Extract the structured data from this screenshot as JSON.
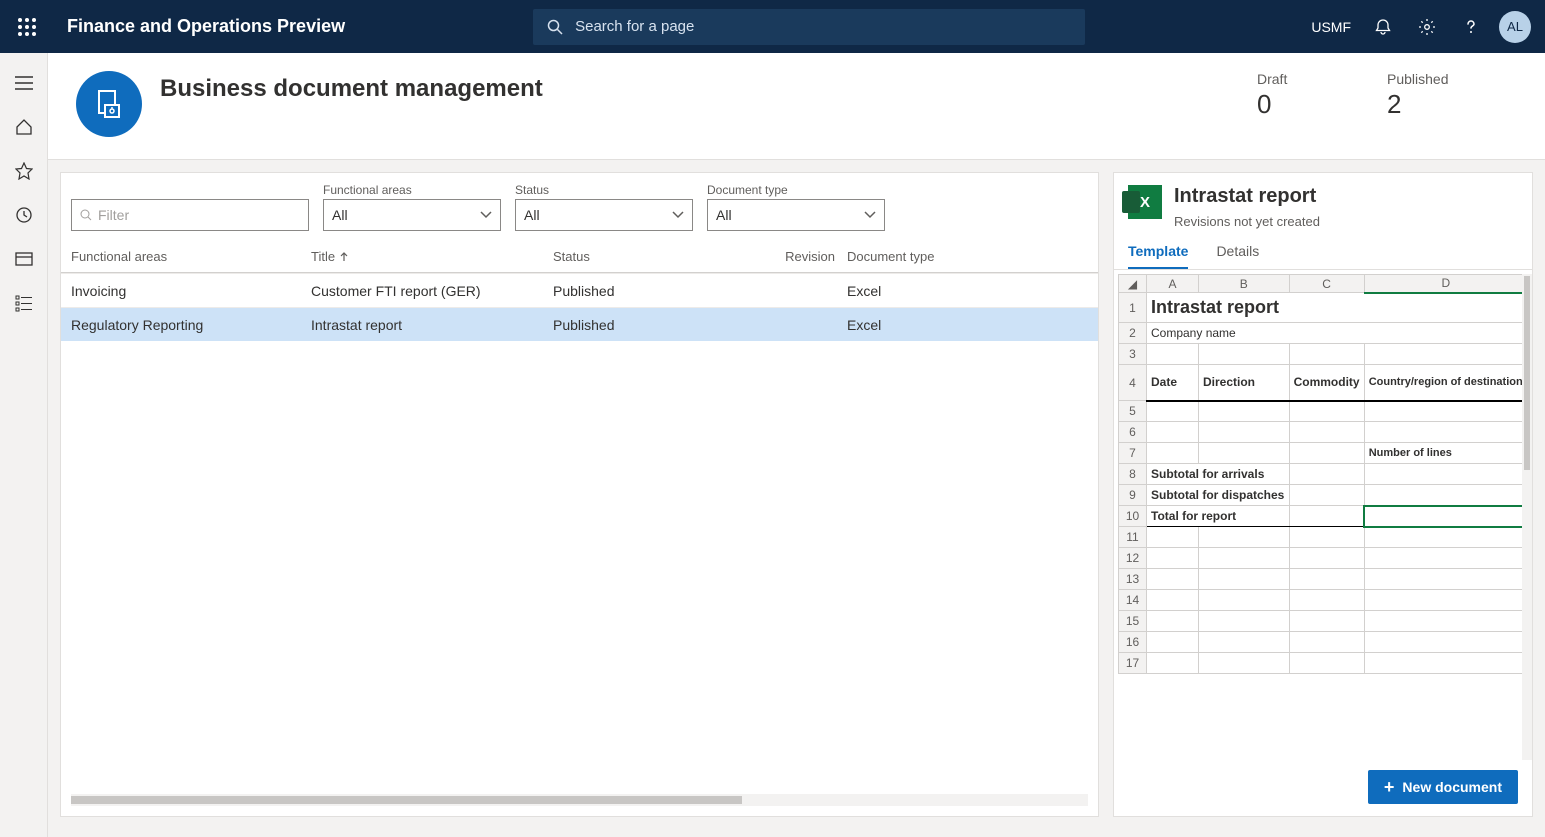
{
  "navbar": {
    "app_title": "Finance and Operations Preview",
    "search_placeholder": "Search for a page",
    "entity": "USMF",
    "avatar": "AL"
  },
  "page": {
    "title": "Business document management",
    "stats": [
      {
        "label": "Draft",
        "value": "0"
      },
      {
        "label": "Published",
        "value": "2"
      }
    ]
  },
  "filters": {
    "filter_placeholder": "Filter",
    "cols": [
      {
        "label": "Functional areas",
        "value": "All"
      },
      {
        "label": "Status",
        "value": "All"
      },
      {
        "label": "Document type",
        "value": "All"
      }
    ]
  },
  "table": {
    "headers": {
      "fa": "Functional areas",
      "title": "Title",
      "status": "Status",
      "rev": "Revision",
      "doc": "Document type"
    },
    "rows": [
      {
        "fa": "Invoicing",
        "title": "Customer FTI report (GER)",
        "status": "Published",
        "rev": "",
        "doc": "Excel",
        "selected": false
      },
      {
        "fa": "Regulatory Reporting",
        "title": "Intrastat report",
        "status": "Published",
        "rev": "",
        "doc": "Excel",
        "selected": true
      }
    ]
  },
  "preview": {
    "title": "Intrastat report",
    "subtitle": "Revisions not yet created",
    "tabs": {
      "template": "Template",
      "details": "Details"
    },
    "excel": {
      "cols": [
        "A",
        "B",
        "C",
        "D"
      ],
      "r1": "Intrastat report",
      "r2": "Company name",
      "r4": {
        "A": "Date",
        "B": "Direction",
        "C": "Commodity",
        "D": "Country/region of destination"
      },
      "r7": {
        "D": "Number of lines"
      },
      "r8": "Subtotal for arrivals",
      "r9": "Subtotal for dispatches",
      "r10": "Total for report"
    },
    "new_doc": "New document"
  }
}
